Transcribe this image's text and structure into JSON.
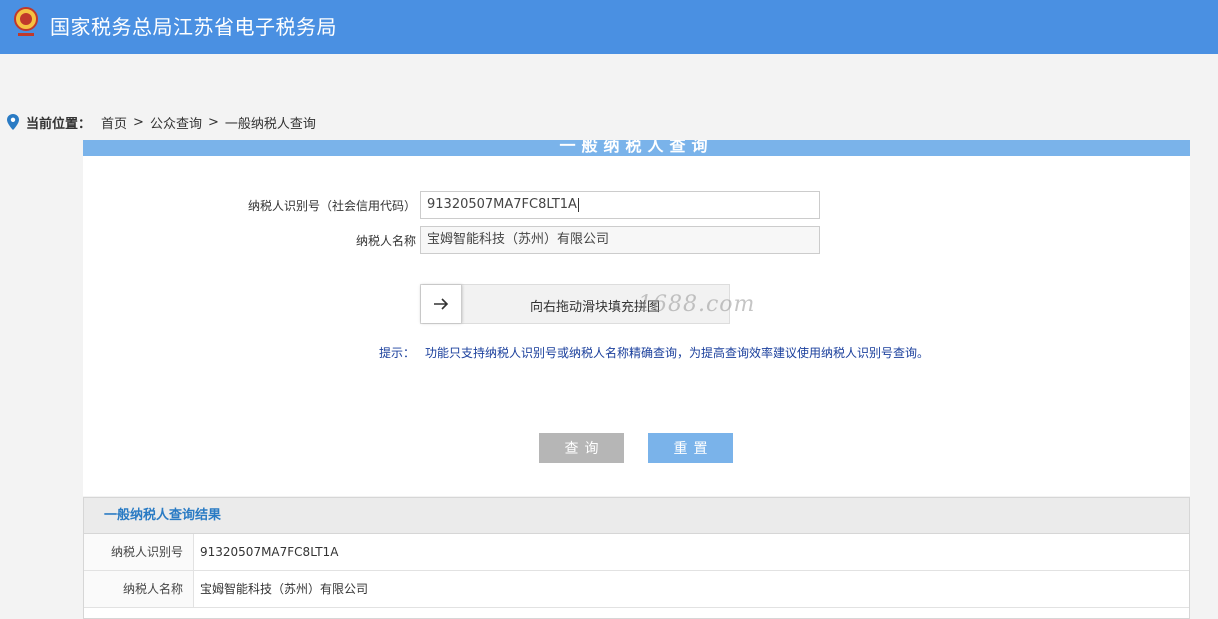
{
  "header": {
    "title": "国家税务总局江苏省电子税务局",
    "emblem_icon": "tax-emblem-icon",
    "bg_color": "#4a90e2"
  },
  "breadcrumb": {
    "label": "当前位置：",
    "items": [
      "首页",
      "公众查询",
      "一般纳税人查询"
    ],
    "separator": ">"
  },
  "form": {
    "section_title": "一般纳税人查询",
    "taxpayer_id_label": "纳税人识别号（社会信用代码）",
    "taxpayer_id_value": "91320507MA7FC8LT1A",
    "taxpayer_name_label": "纳税人名称",
    "taxpayer_name_value": "宝姆智能科技（苏州）有限公司",
    "slider_text": "向右拖动滑块填充拼图",
    "watermark": "1688.com",
    "tip_label": "提示：",
    "tip_text": "功能只支持纳税人识别号或纳税人名称精确查询，为提高查询效率建议使用纳税人识别号查询。",
    "query_button": "查询",
    "reset_button": "重置"
  },
  "results": {
    "title": "一般纳税人查询结果",
    "rows": [
      {
        "label": "纳税人识别号",
        "value": "91320507MA7FC8LT1A"
      },
      {
        "label": "纳税人名称",
        "value": "宝姆智能科技（苏州）有限公司"
      }
    ]
  }
}
